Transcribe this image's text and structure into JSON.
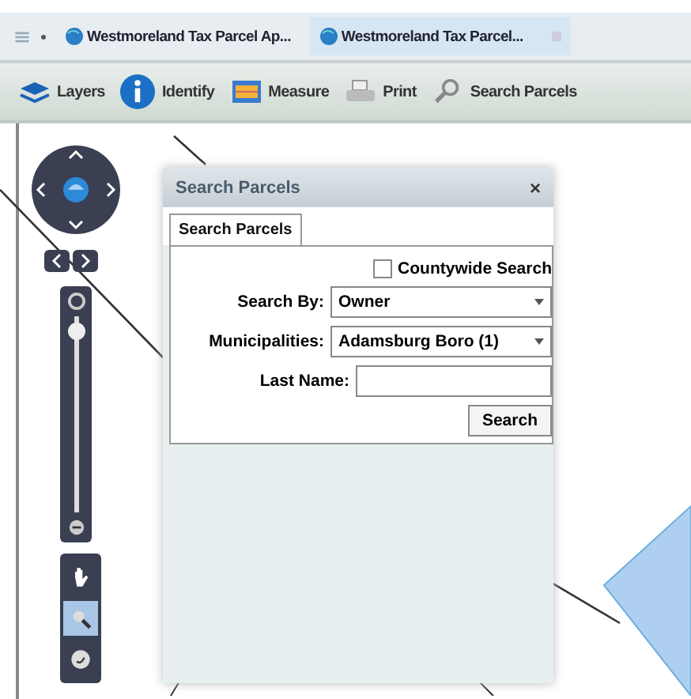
{
  "browser_tabs": [
    {
      "label": "Westmoreland Tax Parcel Ap...",
      "selected": false
    },
    {
      "label": "Westmoreland Tax Parcel...",
      "selected": true
    }
  ],
  "toolbar": [
    {
      "kind": "layers",
      "label": "Layers"
    },
    {
      "kind": "identify",
      "label": "Identify"
    },
    {
      "kind": "measure",
      "label": "Measure"
    },
    {
      "kind": "print",
      "label": "Print"
    },
    {
      "kind": "search",
      "label": "Search Parcels"
    }
  ],
  "map": {
    "zoom_slider": {
      "level": 0.95
    },
    "tools": [
      {
        "kind": "pan",
        "selected": false
      },
      {
        "kind": "zoom",
        "selected": true
      },
      {
        "kind": "back",
        "selected": false
      }
    ]
  },
  "dialog": {
    "title": "Search Parcels",
    "close": "×",
    "tabs": [
      {
        "label": "Search Parcels",
        "selected": true
      }
    ],
    "countywide": {
      "label": "Countywide Search",
      "checked": false
    },
    "fields": [
      {
        "kind": "select",
        "label": "Search By:",
        "value": "Owner"
      },
      {
        "kind": "select",
        "label": "Municipalities:",
        "value": "Adamsburg Boro (1)"
      },
      {
        "kind": "text",
        "label": "Last Name:"
      }
    ],
    "button": "Search"
  }
}
